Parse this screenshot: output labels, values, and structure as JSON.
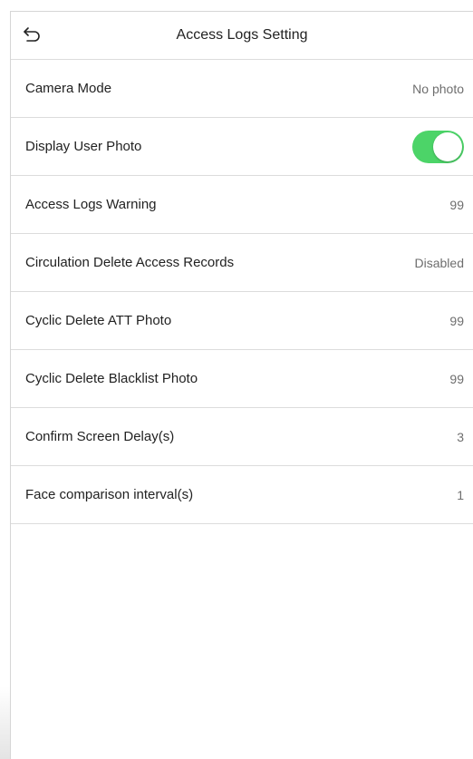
{
  "header": {
    "title": "Access Logs Setting"
  },
  "settings": [
    {
      "label": "Camera Mode",
      "value": "No photo"
    },
    {
      "label": "Display User Photo",
      "toggle_on": true
    },
    {
      "label": "Access Logs Warning",
      "value": "99"
    },
    {
      "label": "Circulation Delete Access Records",
      "value": "Disabled"
    },
    {
      "label": "Cyclic Delete ATT Photo",
      "value": "99"
    },
    {
      "label": "Cyclic Delete Blacklist Photo",
      "value": "99"
    },
    {
      "label": "Confirm Screen Delay(s)",
      "value": "3"
    },
    {
      "label": "Face comparison interval(s)",
      "value": "1"
    }
  ],
  "colors": {
    "toggle_on": "#4cd468",
    "divider": "#dcdcdc"
  },
  "icons": {
    "back": "undo-arrow-icon"
  }
}
